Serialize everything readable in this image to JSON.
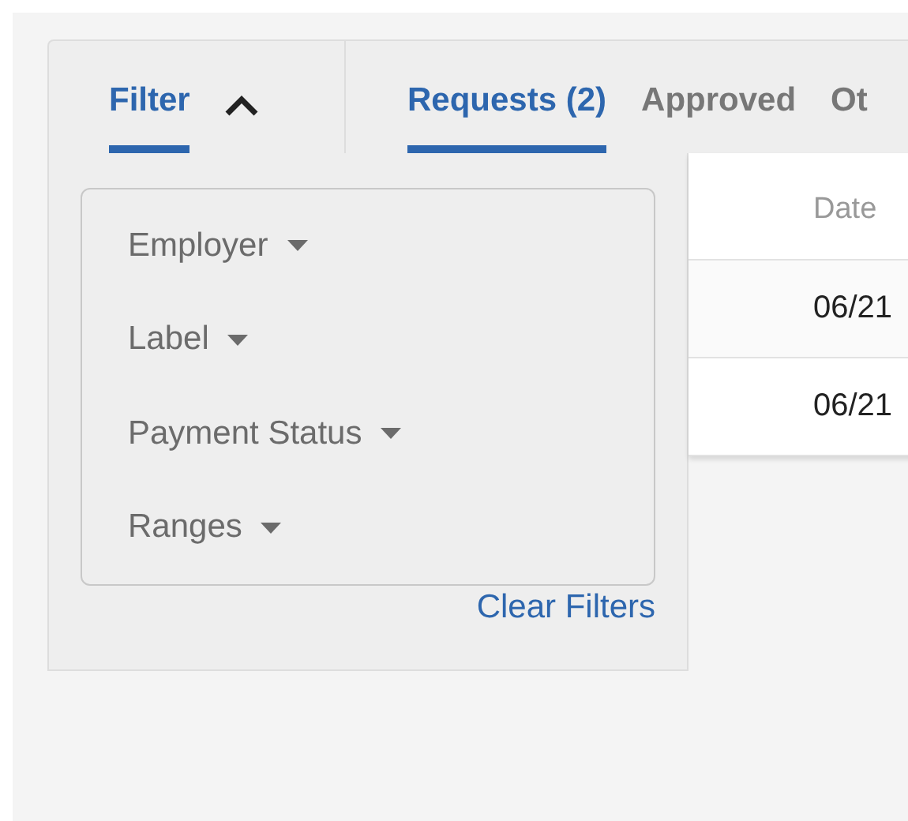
{
  "filter": {
    "label": "Filter",
    "expanded": true
  },
  "tabs": [
    {
      "label": "Requests (2)",
      "selected": true
    },
    {
      "label": "Approved",
      "selected": false
    },
    {
      "label": "Ot",
      "selected": false
    }
  ],
  "filter_panel": {
    "dropdowns": [
      {
        "label": "Employer"
      },
      {
        "label": "Label"
      },
      {
        "label": "Payment Status"
      },
      {
        "label": "Ranges"
      }
    ],
    "clear_link": "Clear Filters"
  },
  "table": {
    "columns": [
      "Date"
    ],
    "rows": [
      [
        "06/21"
      ],
      [
        "06/21"
      ]
    ]
  }
}
